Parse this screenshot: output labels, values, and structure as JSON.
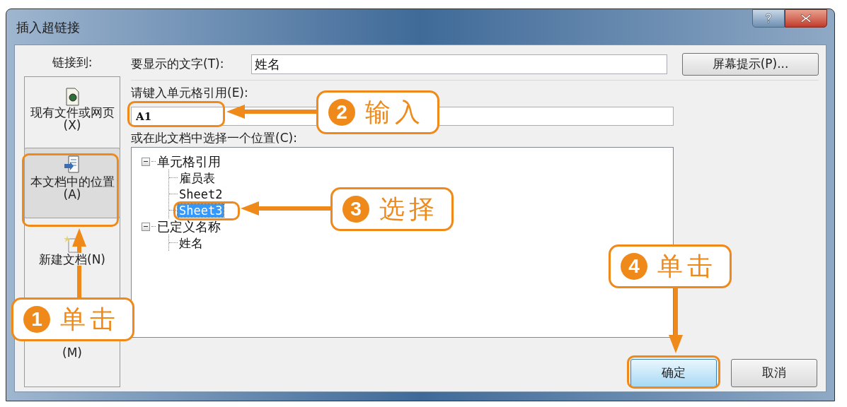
{
  "window": {
    "title": "插入超链接"
  },
  "sidebar": {
    "label": "链接到:",
    "items": [
      {
        "kind": "file",
        "label": "现有文件或网页(X)",
        "selected": false
      },
      {
        "kind": "place",
        "label": "本文档中的位置(A)",
        "selected": true
      },
      {
        "kind": "new",
        "label": "新建文档(N)",
        "selected": false
      },
      {
        "kind": "mail",
        "label": "(M)",
        "selected": false
      }
    ]
  },
  "display_text": {
    "label": "要显示的文字(T):",
    "value": "姓名"
  },
  "screentip_button": "屏幕提示(P)...",
  "cell_ref": {
    "label": "请键入单元格引用(E):",
    "value": "A1"
  },
  "place_label": "或在此文档中选择一个位置(C):",
  "tree": [
    {
      "label": "单元格引用",
      "expanded": true,
      "children": [
        {
          "label": "雇员表",
          "selected": false
        },
        {
          "label": "Sheet2",
          "selected": false
        },
        {
          "label": "Sheet3",
          "selected": true
        }
      ]
    },
    {
      "label": "已定义名称",
      "expanded": true,
      "children": [
        {
          "label": "姓名",
          "selected": false
        }
      ]
    }
  ],
  "buttons": [
    "确定",
    "取消"
  ],
  "annotations": [
    {
      "number": "1",
      "label": "单击"
    },
    {
      "number": "2",
      "label": "输入"
    },
    {
      "number": "3",
      "label": "选择"
    },
    {
      "number": "4",
      "label": "单击"
    }
  ]
}
